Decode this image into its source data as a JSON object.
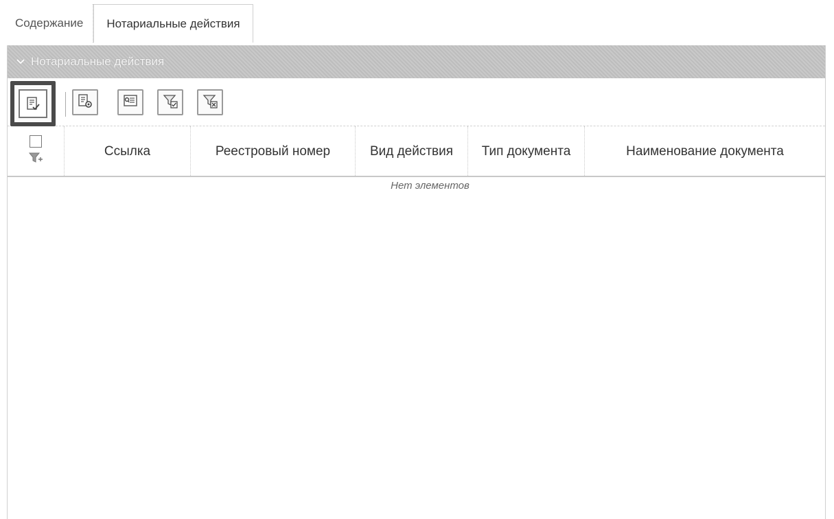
{
  "tabs": [
    {
      "label": "Содержание",
      "active": false
    },
    {
      "label": "Нотариальные действия",
      "active": true
    }
  ],
  "group": {
    "title": "Нотариальные действия",
    "collapsed": false
  },
  "toolbar": {
    "buttons": [
      {
        "name": "select-mode-button",
        "icon": "document-check-icon"
      },
      {
        "name": "settings-button",
        "icon": "document-gear-icon"
      },
      {
        "name": "search-list-button",
        "icon": "list-search-icon"
      },
      {
        "name": "filter-apply-button",
        "icon": "filter-check-icon"
      },
      {
        "name": "filter-clear-button",
        "icon": "filter-clear-icon"
      }
    ]
  },
  "table": {
    "columns": [
      "Ссылка",
      "Реестровый номер",
      "Вид действия",
      "Тип документа",
      "Наименование документа"
    ],
    "empty_text": "Нет элементов"
  },
  "colors": {
    "header_bg": "#c4c4c4",
    "border": "#cfcfcf",
    "text": "#333333"
  }
}
